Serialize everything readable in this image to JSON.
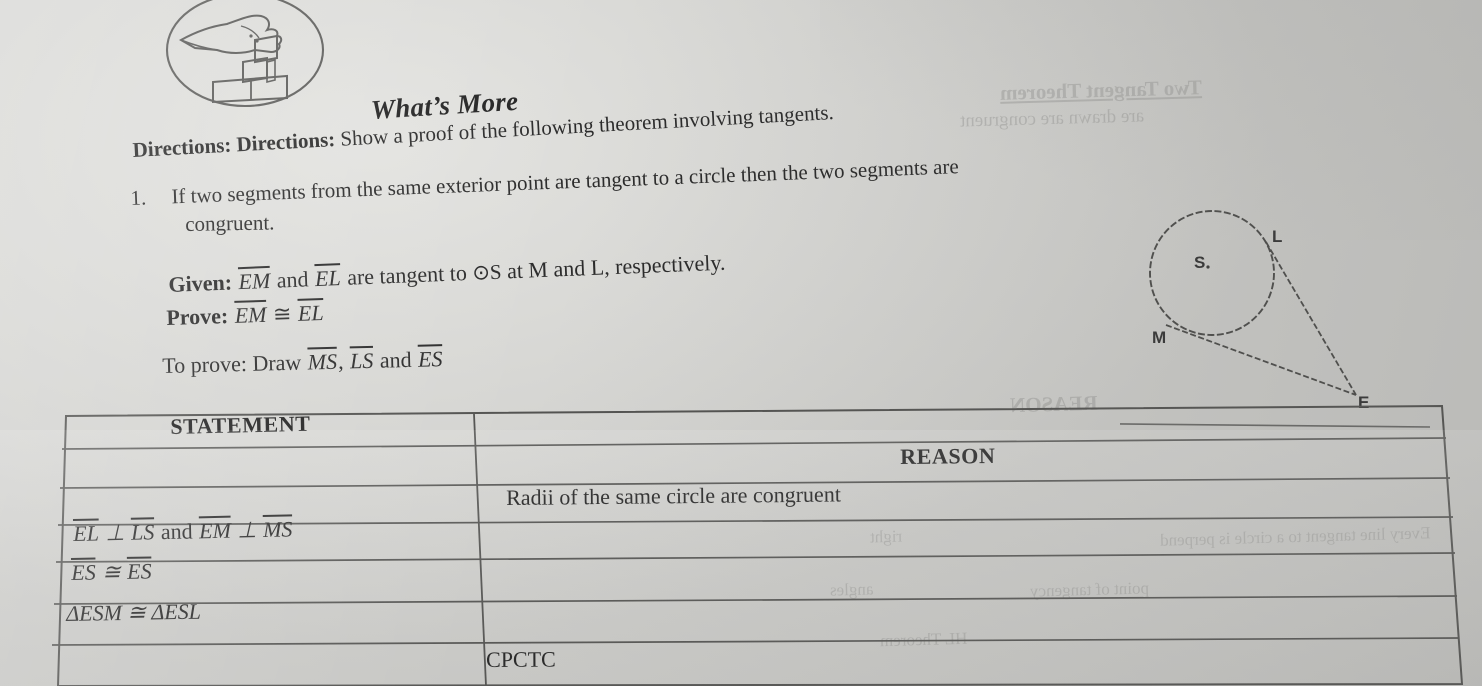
{
  "page": {
    "section_title": "What’s More",
    "icon_name": "hand-stacking-blocks-icon"
  },
  "directions": {
    "label": "Directions:",
    "label2": "Directions:",
    "intro": "Show a proof of the following theorem involving tangents.",
    "item_number": "1.",
    "item_text_line1": "If two segments from the same exterior point are tangent to a circle then the two segments are",
    "item_text_line2": "congruent."
  },
  "given": {
    "given_label": "Given:",
    "given_seg1": "EM",
    "given_and": "and",
    "given_seg2": "EL",
    "given_mid": "are tangent to",
    "given_circle": "⊙S",
    "given_tail": "at M and L, respectively.",
    "prove_label": "Prove:",
    "prove_seg1": "EM",
    "prove_cong": "≅",
    "prove_seg2": "EL",
    "toprove_label": "To prove: Draw",
    "toprove_seg1": "MS",
    "toprove_comma": ",",
    "toprove_seg2": "LS",
    "toprove_and": "and",
    "toprove_seg3": "ES"
  },
  "diagram": {
    "name": "tangent-circle-diagram",
    "center_label": "S",
    "tangent_point_upper": "L",
    "tangent_point_lower": "M",
    "exterior_point": "E"
  },
  "table": {
    "headers": {
      "statement": "STATEMENT",
      "reason": "REASON"
    },
    "rows": [
      {
        "statement": "",
        "reason": ""
      },
      {
        "statement": "",
        "reason": "Radii of the same circle are congruent"
      },
      {
        "statement": "EL ⊥ LS and EM ⊥ MS",
        "reason": ""
      },
      {
        "statement": "ES ≅ ES",
        "reason": ""
      },
      {
        "statement": "ΔESM ≅ ΔESL",
        "reason": ""
      },
      {
        "statement": "",
        "reason": "CPCTC"
      }
    ],
    "cells": {
      "r2_reason": "Radii of the same circle are congruent",
      "r3_stmt_a": "EL",
      "r3_perp": "⊥",
      "r3_stmt_b": "LS",
      "r3_and": "and",
      "r3_stmt_c": "EM",
      "r3_perp2": "⊥",
      "r3_stmt_d": "MS",
      "r4_stmt_a": "ES",
      "r4_cong": "≅",
      "r4_stmt_b": "ES",
      "r5_stmt": "ΔESM ≅ ΔESL",
      "r6_reason": "CPCTC"
    }
  },
  "bleed_through": {
    "line_a": "Two Tangent Theorem",
    "line_b": "are drawn are congruent",
    "line_c": "REASON",
    "line_d": "Every line tangent to a circle is perpend",
    "line_e": "point of tangency",
    "line_f": "HL Theorem",
    "line_g": "right",
    "line_h": "angles"
  }
}
